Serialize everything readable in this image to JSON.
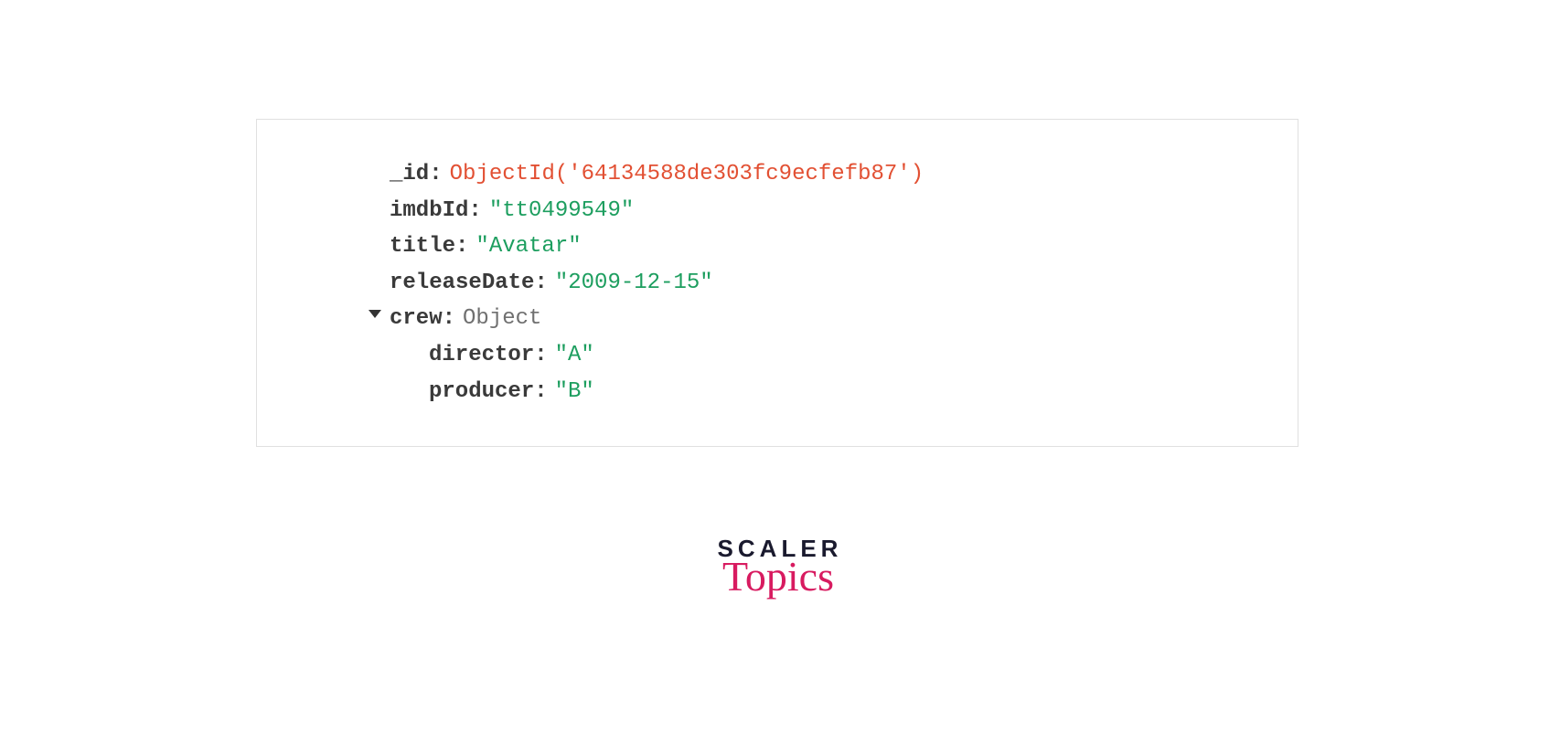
{
  "document": {
    "id_key": "_id",
    "id_value": "ObjectId('64134588de303fc9ecfefb87')",
    "imdbId_key": "imdbId",
    "imdbId_value": "\"tt0499549\"",
    "title_key": "title",
    "title_value": "\"Avatar\"",
    "releaseDate_key": "releaseDate",
    "releaseDate_value": "\"2009-12-15\"",
    "crew_key": "crew",
    "crew_value": "Object",
    "director_key": "director",
    "director_value": "\"A\"",
    "producer_key": "producer",
    "producer_value": "\"B\""
  },
  "logo": {
    "line1": "SCALER",
    "line2": "Topics"
  }
}
